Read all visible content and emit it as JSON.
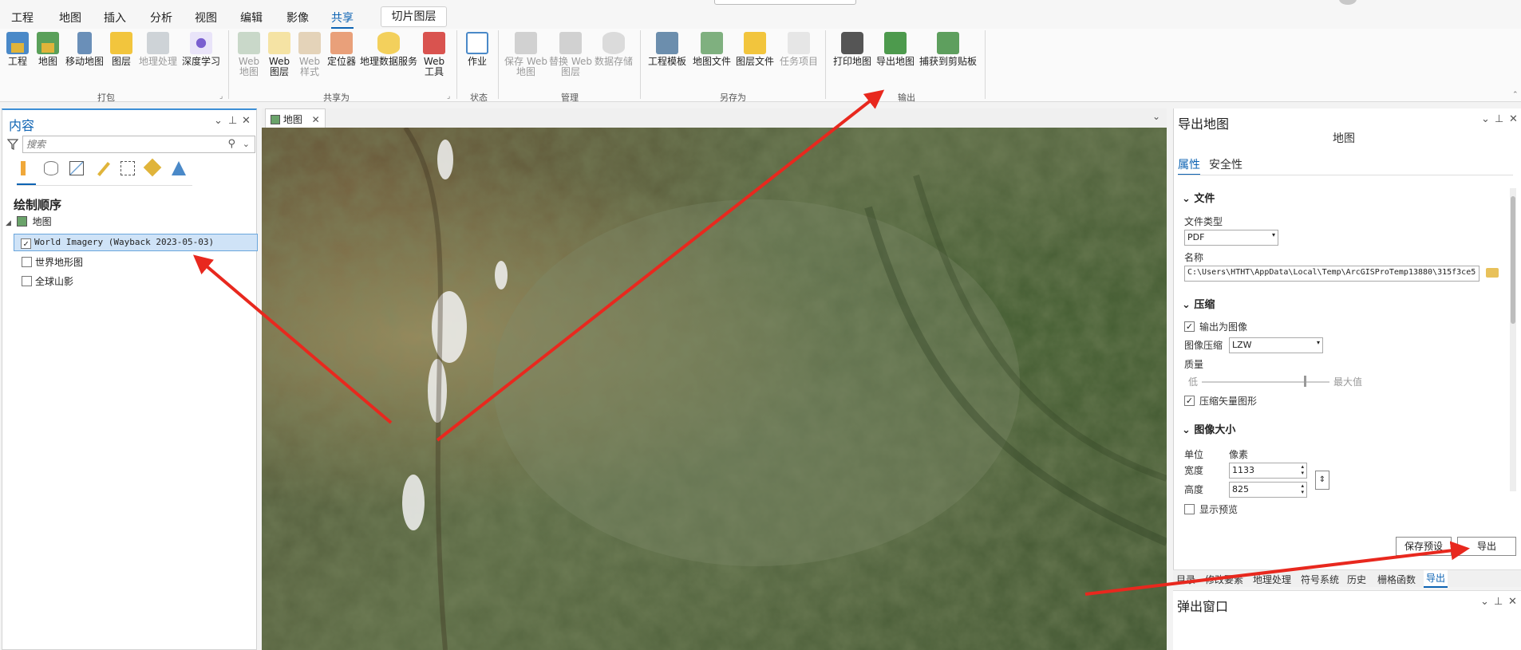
{
  "menu": {
    "items": [
      "工程",
      "地图",
      "插入",
      "分析",
      "视图",
      "编辑",
      "影像",
      "共享"
    ],
    "active": "共享",
    "contextual_tab": "切片图层"
  },
  "ribbon": {
    "groups": {
      "package": "打包",
      "share_as": "共享为",
      "status": "状态",
      "manage": "管理",
      "save_as": "另存为",
      "output": "输出"
    },
    "buttons": {
      "project": "工程",
      "map": "地图",
      "mobile_map": "移动地图",
      "layer": "图层",
      "geoprocessing": "地理处理",
      "deep_learning": "深度学习",
      "web_map": "Web 地图",
      "web_layer": "Web 图层",
      "web_style": "Web 样式",
      "locator": "定位器",
      "geodata_service": "地理数据服务",
      "web_tool": "Web 工具",
      "jobs": "作业",
      "save_web_map": "保存 Web 地图",
      "replace_web_layer": "替换 Web 图层",
      "data_store": "数据存储",
      "project_template": "工程模板",
      "map_file": "地图文件",
      "layer_file": "图层文件",
      "task_item": "任务项目",
      "print_map": "打印地图",
      "export_map": "导出地图",
      "capture_clipboard": "捕获到剪贴板"
    }
  },
  "contents": {
    "title": "内容",
    "search_placeholder": "搜索",
    "section": "绘制顺序",
    "map_name": "地图",
    "layers": [
      {
        "name": "World Imagery (Wayback 2023-05-03)",
        "checked": true,
        "selected": true
      },
      {
        "name": "世界地形图",
        "checked": false
      },
      {
        "name": "全球山影",
        "checked": false
      }
    ]
  },
  "map_view": {
    "tab_label": "地图"
  },
  "export": {
    "title": "导出地图",
    "subtitle": "地图",
    "tabs": [
      "属性",
      "安全性"
    ],
    "file_section": "文件",
    "file_type_label": "文件类型",
    "file_type_value": "PDF",
    "name_label": "名称",
    "name_value": "C:\\Users\\HTHT\\AppData\\Local\\Temp\\ArcGISProTemp13880\\315f3ce5",
    "compress_section": "压缩",
    "output_as_image": "输出为图像",
    "image_compress_label": "图像压缩",
    "image_compress_value": "LZW",
    "quality_label": "质量",
    "quality_low": "低",
    "quality_high": "最大值",
    "quality_level": 0.8,
    "compress_vector": "压缩矢量图形",
    "size_section": "图像大小",
    "unit_label": "单位",
    "unit_value": "像素",
    "width_label": "宽度",
    "width_value": "1133",
    "height_label": "高度",
    "height_value": "825",
    "show_preview": "显示预览",
    "save_preset_button": "保存预设",
    "export_button": "导出"
  },
  "bottom_tabs": [
    "目录",
    "修改要素",
    "地理处理",
    "符号系统",
    "历史",
    "栅格函数",
    "导出"
  ],
  "bottom_tab_active": "导出",
  "popup": {
    "title": "弹出窗口"
  },
  "colors": {
    "accent": "#0d63b3",
    "arrow": "#e8281e",
    "selection": "#cfe3f7"
  }
}
